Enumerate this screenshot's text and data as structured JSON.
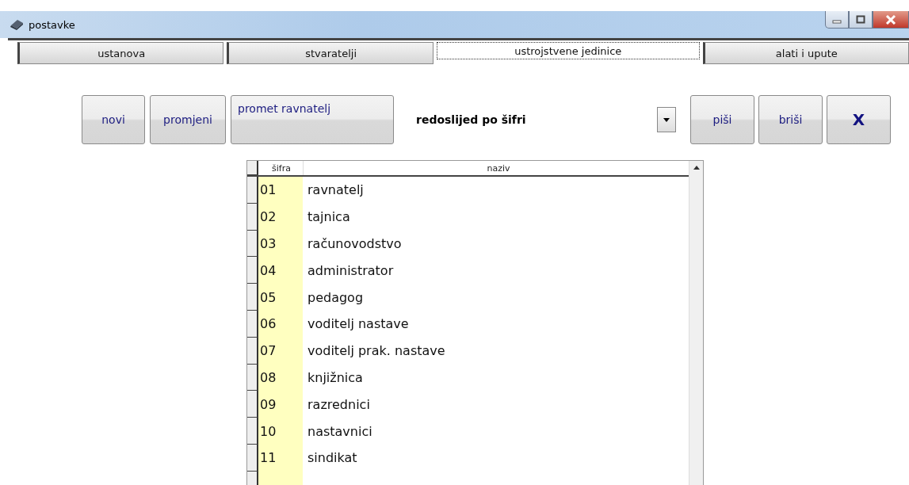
{
  "window": {
    "title": "postavke"
  },
  "tabs": [
    {
      "label": "ustanova",
      "selected": false
    },
    {
      "label": "stvaratelji",
      "selected": false
    },
    {
      "label": "ustrojstvene jedinice",
      "selected": true
    },
    {
      "label": "alati i upute",
      "selected": false
    }
  ],
  "toolbar_left": [
    {
      "label": "novi"
    },
    {
      "label": "promjeni"
    },
    {
      "label": "promet ravnatelj"
    }
  ],
  "sort": {
    "value": "redoslijed po šifri"
  },
  "toolbar_right": [
    {
      "label": "piši",
      "kind": "text"
    },
    {
      "label": "briši",
      "kind": "text"
    },
    {
      "label": "X",
      "kind": "close"
    }
  ],
  "table": {
    "columns": [
      "šifra",
      "naziv"
    ],
    "rows": [
      [
        "01",
        "ravnatelj"
      ],
      [
        "02",
        "tajnica"
      ],
      [
        "03",
        "računovodstvo"
      ],
      [
        "04",
        "administrator"
      ],
      [
        "05",
        "pedagog"
      ],
      [
        "06",
        "voditelj nastave"
      ],
      [
        "07",
        "voditelj prak. nastave"
      ],
      [
        "08",
        "knjižnica"
      ],
      [
        "09",
        "razrednici"
      ],
      [
        "10",
        "nastavnici"
      ],
      [
        "11",
        "sindikat"
      ]
    ]
  }
}
